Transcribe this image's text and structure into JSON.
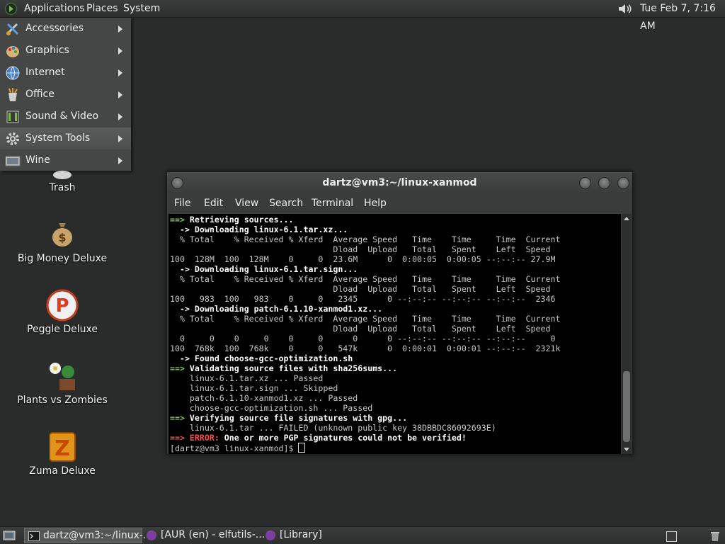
{
  "top_panel": {
    "menus": [
      "Applications",
      "Places",
      "System"
    ],
    "clock": "Tue Feb  7, 7:16 AM"
  },
  "app_menu": {
    "items": [
      {
        "label": "Accessories",
        "icon": "accessories-icon"
      },
      {
        "label": "Graphics",
        "icon": "graphics-icon"
      },
      {
        "label": "Internet",
        "icon": "internet-icon"
      },
      {
        "label": "Office",
        "icon": "office-icon"
      },
      {
        "label": "Sound & Video",
        "icon": "sound-video-icon"
      },
      {
        "label": "System Tools",
        "icon": "system-tools-icon"
      },
      {
        "label": "Wine",
        "icon": "wine-icon"
      }
    ],
    "highlighted": "System Tools"
  },
  "desktop": {
    "icons": [
      {
        "label": "Trash"
      },
      {
        "label": "Big Money Deluxe"
      },
      {
        "label": "Peggle Deluxe"
      },
      {
        "label": "Plants vs Zombies"
      },
      {
        "label": "Zuma Deluxe"
      }
    ]
  },
  "terminal": {
    "title": "dartz@vm3:~/linux-xanmod",
    "menu": [
      "File",
      "Edit",
      "View",
      "Search",
      "Terminal",
      "Help"
    ],
    "lines": {
      "l1_arrow": "==>",
      "l1_text": " Retrieving sources...",
      "l2": "  -> Downloading linux-6.1.tar.xz...",
      "hdr1": "  % Total    % Received % Xferd  Average Speed   Time    Time     Time  Current",
      "hdr2": "                                 Dload  Upload   Total   Spent    Left  Speed",
      "d1": "100  128M  100  128M    0     0  23.6M      0  0:00:05  0:00:05 --:--:-- 27.9M",
      "l3": "  -> Downloading linux-6.1.tar.sign...",
      "d2": "100   983  100   983    0     0   2345      0 --:--:-- --:--:-- --:--:--  2346",
      "l4": "  -> Downloading patch-6.1.10-xanmod1.xz...",
      "d3a": "  0     0    0     0    0     0      0      0 --:--:-- --:--:-- --:--:--     0",
      "d3b": "100  768k  100  768k    0     0   547k      0  0:00:01  0:00:01 --:--:--  2321k",
      "l5": "  -> Found choose-gcc-optimization.sh",
      "l6_arrow": "==>",
      "l6_text": " Validating source files with sha256sums...",
      "v1": "    linux-6.1.tar.xz ... Passed",
      "v2": "    linux-6.1.tar.sign ... Skipped",
      "v3": "    patch-6.1.10-xanmod1.xz ... Passed",
      "v4": "    choose-gcc-optimization.sh ... Passed",
      "l7_arrow": "==>",
      "l7_text": " Verifying source file signatures with gpg...",
      "f1": "    linux-6.1.tar ... FAILED (unknown public key 38DBBDC86092693E)",
      "e_arrow": "==>",
      "e_label": " ERROR:",
      "e_text": " One or more PGP signatures could not be verified!",
      "prompt": "[dartz@vm3 linux-xanmod]$ "
    }
  },
  "taskbar": {
    "tasks": [
      {
        "label": "dartz@vm3:~/linux-...",
        "icon": "terminal-icon",
        "active": true
      },
      {
        "label": "[AUR (en) - elfutils-...",
        "icon": "firefox-icon",
        "active": false
      },
      {
        "label": "[Library]",
        "icon": "firefox-icon",
        "active": false
      }
    ]
  }
}
